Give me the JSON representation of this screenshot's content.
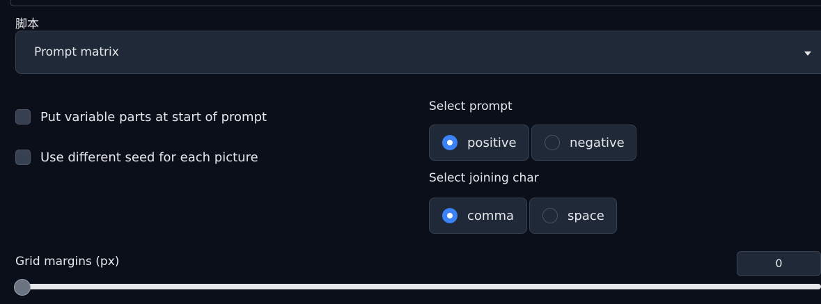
{
  "script": {
    "label": "脚本",
    "selected": "Prompt matrix"
  },
  "options": {
    "variable_parts_label": "Put variable parts at start of prompt",
    "variable_parts_checked": false,
    "different_seed_label": "Use different seed for each picture",
    "different_seed_checked": false
  },
  "select_prompt": {
    "title": "Select prompt",
    "options": [
      "positive",
      "negative"
    ],
    "selected": "positive"
  },
  "select_joining": {
    "title": "Select joining char",
    "options": [
      "comma",
      "space"
    ],
    "selected": "comma"
  },
  "grid_margins": {
    "label": "Grid margins (px)",
    "value": "0"
  },
  "colors": {
    "background": "#0b0f19",
    "panel": "#1f2937",
    "accent": "#3b82f6",
    "text": "#e5e7eb"
  }
}
